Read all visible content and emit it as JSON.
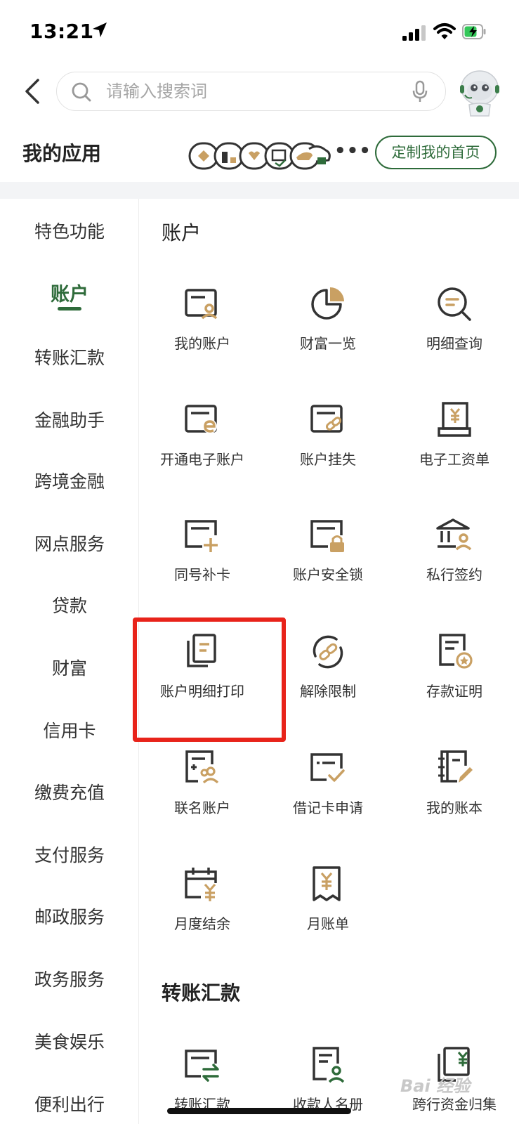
{
  "status_bar": {
    "time": "13:21"
  },
  "search": {
    "placeholder": "请输入搜索词"
  },
  "my_apps": {
    "title": "我的应用",
    "more": "•••",
    "customize_label": "定制我的首页"
  },
  "sidebar": {
    "items": [
      {
        "label": "特色功能"
      },
      {
        "label": "账户",
        "active": true
      },
      {
        "label": "转账汇款"
      },
      {
        "label": "金融助手"
      },
      {
        "label": "跨境金融"
      },
      {
        "label": "网点服务"
      },
      {
        "label": "贷款"
      },
      {
        "label": "财富"
      },
      {
        "label": "信用卡"
      },
      {
        "label": "缴费充值"
      },
      {
        "label": "支付服务"
      },
      {
        "label": "邮政服务"
      },
      {
        "label": "政务服务"
      },
      {
        "label": "美食娱乐"
      },
      {
        "label": "便利出行"
      }
    ]
  },
  "sections": [
    {
      "title": "账户",
      "items": [
        {
          "label": "我的账户",
          "icon": "card-person-icon"
        },
        {
          "label": "财富一览",
          "icon": "pie-chart-icon"
        },
        {
          "label": "明细查询",
          "icon": "magnifier-list-icon"
        },
        {
          "label": "开通电子账户",
          "icon": "card-e-icon"
        },
        {
          "label": "账户挂失",
          "icon": "card-link-icon"
        },
        {
          "label": "电子工资单",
          "icon": "payslip-scroll-icon"
        },
        {
          "label": "同号补卡",
          "icon": "card-plus-icon"
        },
        {
          "label": "账户安全锁",
          "icon": "card-lock-icon"
        },
        {
          "label": "私行签约",
          "icon": "bank-person-icon"
        },
        {
          "label": "账户明细打印",
          "icon": "documents-copy-icon"
        },
        {
          "label": "解除限制",
          "icon": "unlock-circle-icon"
        },
        {
          "label": "存款证明",
          "icon": "doc-star-icon"
        },
        {
          "label": "联名账户",
          "icon": "doc-two-people-icon"
        },
        {
          "label": "借记卡申请",
          "icon": "card-check-icon"
        },
        {
          "label": "我的账本",
          "icon": "notebook-pen-icon"
        },
        {
          "label": "月度结余",
          "icon": "calendar-yuan-icon"
        },
        {
          "label": "月账单",
          "icon": "bill-yuan-icon"
        }
      ]
    },
    {
      "title": "转账汇款",
      "items": [
        {
          "label": "转账汇款",
          "icon": "card-transfer-icon"
        },
        {
          "label": "收款人名册",
          "icon": "doc-person-icon"
        },
        {
          "label": "跨行资金归集",
          "icon": "documents-yuan-icon"
        }
      ]
    }
  ],
  "colors": {
    "accent": "#2e6b3a",
    "icon_dark": "#333333",
    "icon_gold": "#c9a063",
    "highlight": "#e8231a"
  },
  "watermark": "Bai 经验"
}
